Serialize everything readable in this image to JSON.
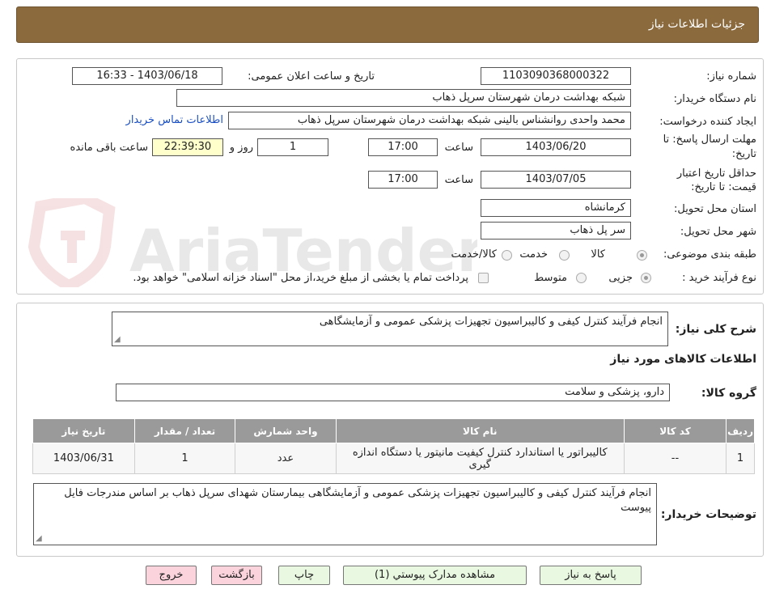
{
  "header": {
    "title": "جزئیات اطلاعات نیاز"
  },
  "watermark": {
    "text": "AriaTender.neT"
  },
  "info": {
    "need_number_label": "شماره نیاز:",
    "need_number": "1103090368000322",
    "announce_label": "تاریخ و ساعت اعلان عمومی:",
    "announce_value": "1403/06/18 - 16:33",
    "buyer_org_label": "نام دستگاه خریدار:",
    "buyer_org": "شبکه بهداشت درمان شهرستان سرپل ذهاب",
    "creator_label": "ایجاد کننده درخواست:",
    "creator": "محمد واحدی روانشناس بالینی شبکه بهداشت درمان شهرستان سرپل ذهاب",
    "contact_link": "اطلاعات تماس خریدار",
    "deadline_label_1": "مهلت ارسال پاسخ: تا",
    "deadline_label_2": "تاریخ:",
    "deadline_date": "1403/06/20",
    "time_label": "ساعت",
    "deadline_time": "17:00",
    "days_value": "1",
    "days_label": "روز و",
    "remaining_time": "22:39:30",
    "remaining_label": "ساعت باقی مانده",
    "validity_label_1": "حداقل تاریخ اعتبار",
    "validity_label_2": "قیمت: تا تاریخ:",
    "validity_date": "1403/07/05",
    "validity_time": "17:00",
    "province_label": "استان محل تحویل:",
    "province": "کرمانشاه",
    "city_label": "شهر محل تحویل:",
    "city": "سر پل ذهاب",
    "category_label": "طبقه بندی موضوعی:",
    "category_options": [
      "کالا",
      "خدمت",
      "کالا/خدمت"
    ],
    "process_label": "نوع فرآیند خرید :",
    "process_options": [
      "جزیی",
      "متوسط"
    ],
    "payment_note": "پرداخت تمام یا بخشی از مبلغ خرید،از محل \"اسناد خزانه اسلامی\" خواهد بود."
  },
  "need": {
    "summary_label": "شرح کلی نیاز:",
    "summary": "انجام فرآیند کنترل کیفی و کالیبراسیون تجهیزات پزشکی عمومی و آزمایشگاهی",
    "goods_title": "اطلاعات کالاهای مورد نیاز",
    "group_label": "گروه کالا:",
    "group": "دارو، پزشکی و سلامت",
    "table": {
      "headers": [
        "ردیف",
        "کد کالا",
        "نام کالا",
        "واحد شمارش",
        "تعداد / مقدار",
        "تاریخ نیاز"
      ],
      "rows": [
        [
          "1",
          "--",
          "کالیبراتور یا استاندارد کنترل کیفیت مانیتور یا دستگاه اندازه گیری",
          "عدد",
          "1",
          "1403/06/31"
        ]
      ]
    },
    "buyer_notes_label": "توضیحات خریدار:",
    "buyer_notes": "انجام فرآیند کنترل کیفی و کالیبراسیون تجهیزات پزشکی عمومی و آزمایشگاهی بیمارستان شهدای سرپل ذهاب بر اساس مندرجات فایل پیوست"
  },
  "buttons": {
    "reply": "پاسخ به نیاز",
    "attachments": "مشاهده مدارک پیوستي (1)",
    "print": "چاپ",
    "back": "بازگشت",
    "exit": "خروج"
  }
}
